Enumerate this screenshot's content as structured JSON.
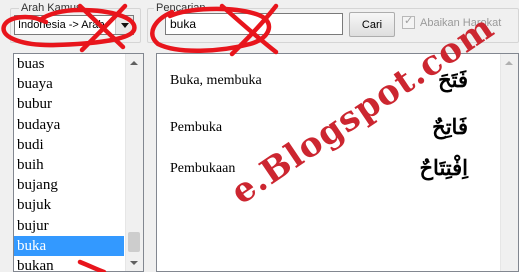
{
  "dictionary_group": {
    "label": "Arah Kamus",
    "combo_value": "Indonesia -> Arab"
  },
  "search_group": {
    "label": "Pencarian",
    "input_value": "buka",
    "button_label": "Cari",
    "checkbox_label": "Abaikan Harokat",
    "checkbox_checked": true
  },
  "word_list": {
    "items": [
      "buas",
      "buaya",
      "bubur",
      "budaya",
      "budi",
      "buih",
      "bujang",
      "bujuk",
      "bujur",
      "buka",
      "bukan"
    ],
    "selected": "buka"
  },
  "results": [
    {
      "indonesian": "Buka, membuka",
      "arabic": "فَتَحَ"
    },
    {
      "indonesian": "Pembuka",
      "arabic": "فَاتِحٌ"
    },
    {
      "indonesian": "Pembukaan",
      "arabic": "اِفْتِتَاحٌ"
    }
  ],
  "watermark": "e.Blogspot.com",
  "colors": {
    "selection": "#3399ff",
    "annotation_red": "#e8151c"
  }
}
